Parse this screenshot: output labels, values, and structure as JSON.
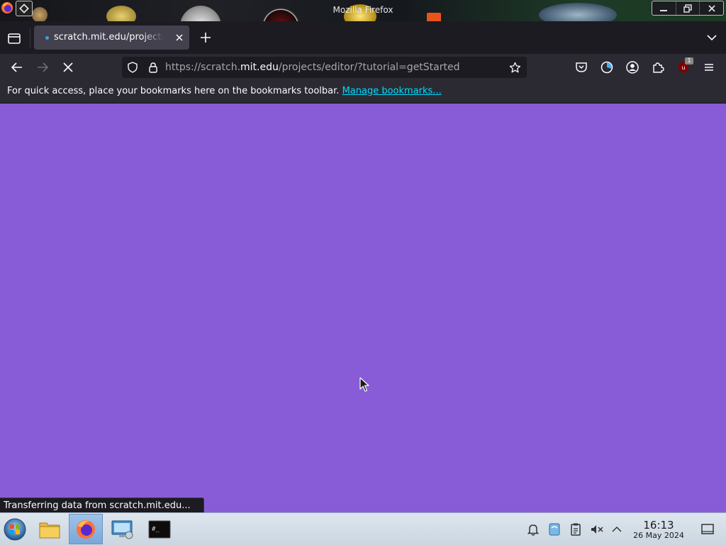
{
  "window": {
    "title": "Mozilla Firefox",
    "buttons": [
      "minimize-icon",
      "restore-icon",
      "close-icon"
    ]
  },
  "tabs": [
    {
      "title": "scratch.mit.edu/projects/editor/?tutorial=getStarted",
      "active": true,
      "loading": true
    }
  ],
  "navbar": {
    "url_prefix": "https://scratch.",
    "url_host": "mit.edu",
    "url_path": "/projects/editor/?tutorial=getStarted",
    "extension_badge": "1"
  },
  "bookmarks_bar": {
    "message": "For quick access, place your bookmarks here on the bookmarks toolbar.",
    "link": "Manage bookmarks..."
  },
  "content": {
    "background": "#885cd6"
  },
  "status": {
    "text": "Transferring data from scratch.mit.edu..."
  },
  "taskbar": {
    "time": "16:13",
    "date": "26 May 2024",
    "apps": [
      "file-manager",
      "firefox",
      "system-settings",
      "terminal"
    ]
  }
}
